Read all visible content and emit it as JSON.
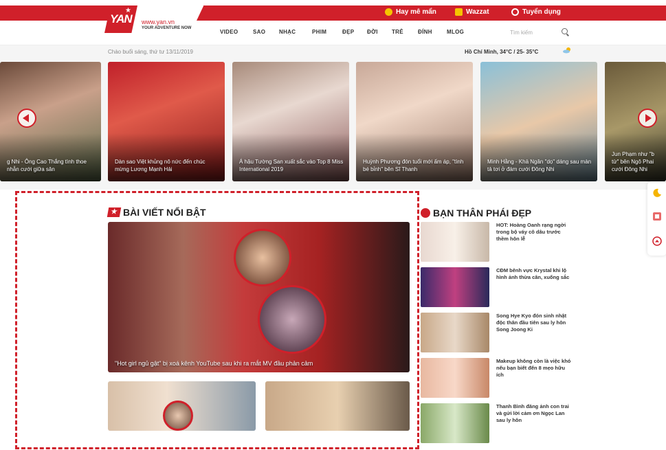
{
  "topbar": {
    "links": [
      {
        "label": "Hay mê mẩn",
        "icon": "flame-icon",
        "color": "#f5c400"
      },
      {
        "label": "Wazzat",
        "icon": "wazzat-icon",
        "color": "#f5c400"
      },
      {
        "label": "Tuyển dụng",
        "icon": "clock-icon",
        "color": "#ffffff"
      }
    ]
  },
  "nav": {
    "logo_text": "YAN",
    "site_url": "www.yan.vn",
    "tagline": "YOUR ADVENTURE NOW",
    "menu": [
      "VIDEO",
      "SAO",
      "NHẠC",
      "PHIM",
      "ĐẸP",
      "ĐỜI",
      "TRẺ",
      "ĐÍNH",
      "MLOG"
    ],
    "search_placeholder": "Tìm kiếm"
  },
  "greeting": "Chào buổi sáng, thứ tư 13/11/2019",
  "weather": "Hồ Chí Minh, 34°C / 25- 35°C",
  "slider": {
    "slides": [
      {
        "caption": "g Nhi - Ông Cao Thắng tình thoe nhẫn cưới giữa sân"
      },
      {
        "caption": "Dàn sao Việt khủng nô nức đến chúc mừng Lương Mạnh Hải"
      },
      {
        "caption": "Á hậu Tường San xuất sắc vào Top 8 Miss International 2019"
      },
      {
        "caption": "Huỳnh Phương đón tuổi mới ấm áp, \"tình bé bỉnh\" bên Sĩ Thanh"
      },
      {
        "caption": "Minh Hằng - Khả Ngân \"dọ\" dáng sau màn tả tơi ở đám cưới Đông Nhi"
      },
      {
        "caption": "Jun Phạm như \"b từ\" bên Ngô Phai cưới Đông Nhi"
      }
    ]
  },
  "featured": {
    "title": "BÀI VIẾT NỔI BẬT",
    "hero_caption": "\"Hot girl ngủ gật\" bị xoá kênh YouTube sau khi ra mắt MV đầu phản cảm"
  },
  "sidebar": {
    "title": "BẠN THÂN PHÁI ĐẸP",
    "items": [
      {
        "text": "HOT: Hoàng Oanh rạng ngời trong bộ váy cô dâu trước thềm hôn lễ"
      },
      {
        "text": "CĐM bênh vực Krystal khi lộ hình ảnh thừa cân, xuống sắc"
      },
      {
        "text": "Song Hye Kyo đón sinh nhật độc thân đầu tiên sau ly hôn Song Joong Ki"
      },
      {
        "text": "Makeup không còn là việc khó nếu bạn biết đến 8 mẹo hữu ích"
      },
      {
        "text": "Thanh Bình đăng ảnh con trai và gửi lời cảm ơn Ngọc Lan sau ly hôn"
      }
    ]
  },
  "colors": {
    "brand_red": "#d0202a"
  }
}
